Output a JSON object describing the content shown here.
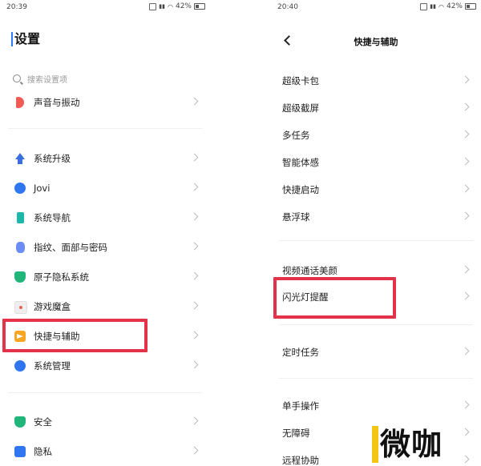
{
  "left": {
    "status": {
      "time": "20:39",
      "battery": "42%"
    },
    "title": "设置",
    "search_placeholder": "搜索设置项",
    "items": [
      {
        "label": "声音与振动",
        "icon": "speaker-icon"
      },
      {
        "label": "系统升级",
        "icon": "upgrade-arrow-icon"
      },
      {
        "label": "Jovi",
        "icon": "jovi-icon"
      },
      {
        "label": "系统导航",
        "icon": "navigation-phone-icon"
      },
      {
        "label": "指纹、面部与密码",
        "icon": "fingerprint-icon"
      },
      {
        "label": "原子隐私系统",
        "icon": "privacy-shield-icon"
      },
      {
        "label": "游戏魔盒",
        "icon": "game-box-icon"
      },
      {
        "label": "快捷与辅助",
        "icon": "shortcut-arrow-icon"
      },
      {
        "label": "系统管理",
        "icon": "system-hexagon-icon"
      },
      {
        "label": "安全",
        "icon": "security-shield-icon"
      },
      {
        "label": "隐私",
        "icon": "privacy-lock-icon"
      }
    ],
    "highlighted": "快捷与辅助"
  },
  "right": {
    "status": {
      "time": "20:40",
      "battery": "42%"
    },
    "title": "快捷与辅助",
    "items": [
      {
        "label": "超级卡包"
      },
      {
        "label": "超级截屏"
      },
      {
        "label": "多任务"
      },
      {
        "label": "智能体感"
      },
      {
        "label": "快捷启动"
      },
      {
        "label": "悬浮球"
      },
      {
        "label": "视频通话美颜"
      },
      {
        "label": "闪光灯提醒"
      },
      {
        "label": "定时任务"
      },
      {
        "label": "单手操作"
      },
      {
        "label": "无障碍"
      },
      {
        "label": "远程协助"
      }
    ],
    "highlighted": "闪光灯提醒"
  },
  "watermark": {
    "text": "微咖"
  },
  "colors": {
    "highlight": "#e3324a",
    "accent": "#2b7bff",
    "watermark_yellow": "#f3c515"
  }
}
